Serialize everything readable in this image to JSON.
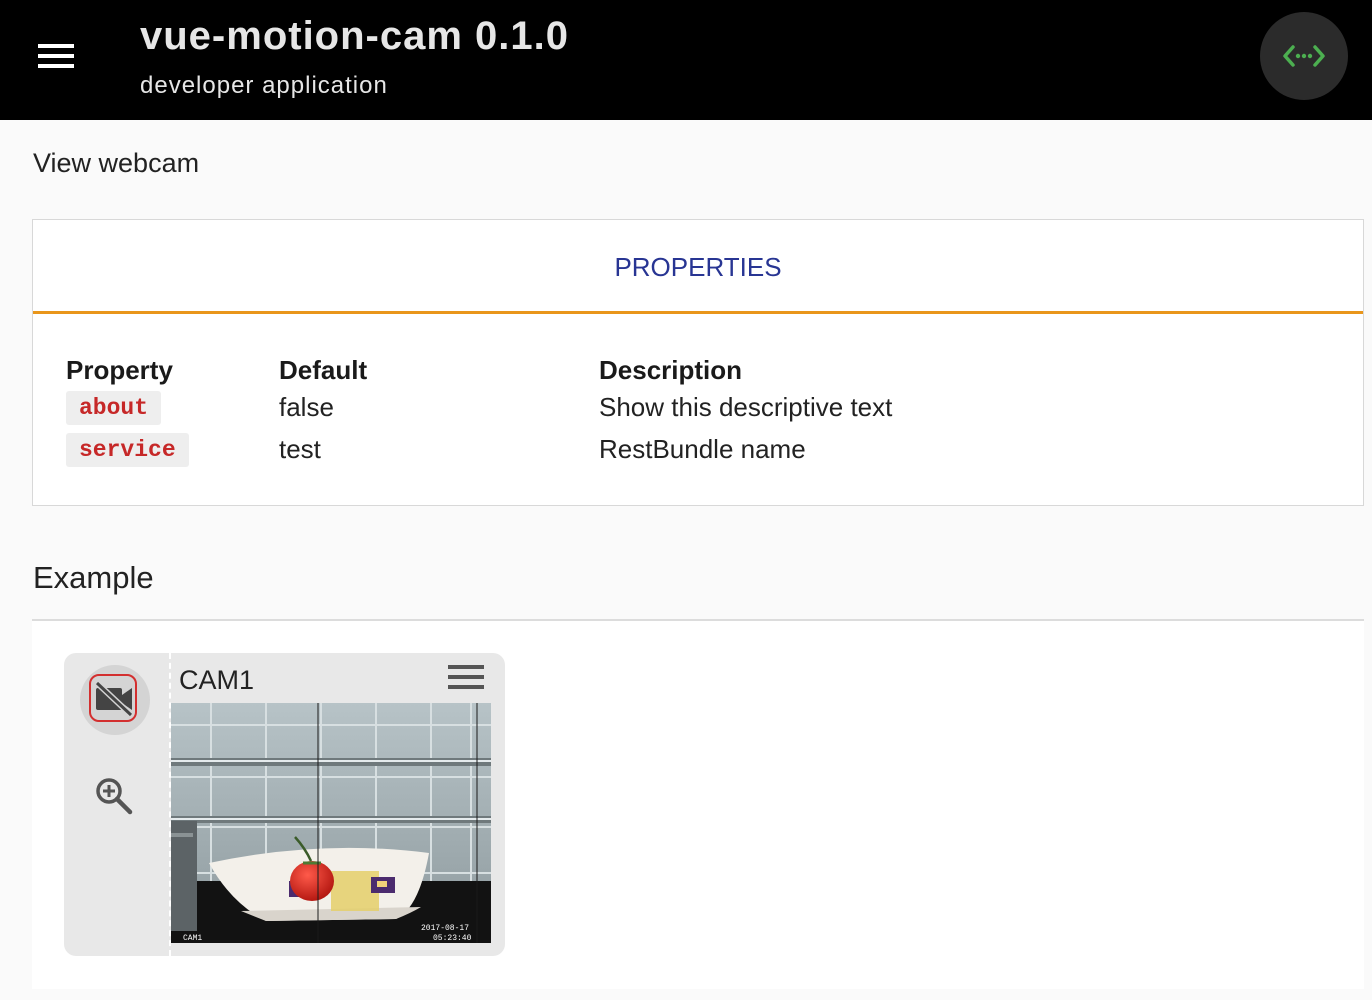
{
  "app": {
    "title": "vue-motion-cam 0.1.0",
    "subtitle": "developer application"
  },
  "page": {
    "heading": "View webcam"
  },
  "properties": {
    "tab_label": "PROPERTIES",
    "columns": [
      "Property",
      "Default",
      "Description"
    ],
    "rows": [
      {
        "property": "about",
        "default": "false",
        "description": "Show this descriptive text"
      },
      {
        "property": "service",
        "default": "test",
        "description": "RestBundle name"
      }
    ]
  },
  "example": {
    "heading": "Example",
    "camera": {
      "name": "CAM1",
      "overlay_label": "CAM1",
      "overlay_date": "2017-08-17",
      "overlay_time": "05:23:40"
    }
  },
  "colors": {
    "accent": "#e9961b",
    "tab_text": "#283593",
    "code_text": "#c62828",
    "code_icon": "#4caf50",
    "toggle_border": "#d32f2f"
  },
  "icons": {
    "menu": "menu-icon",
    "code": "code-icon",
    "camera_off": "videocam-off-icon",
    "zoom": "zoom-in-icon",
    "camera_menu": "menu-icon"
  }
}
